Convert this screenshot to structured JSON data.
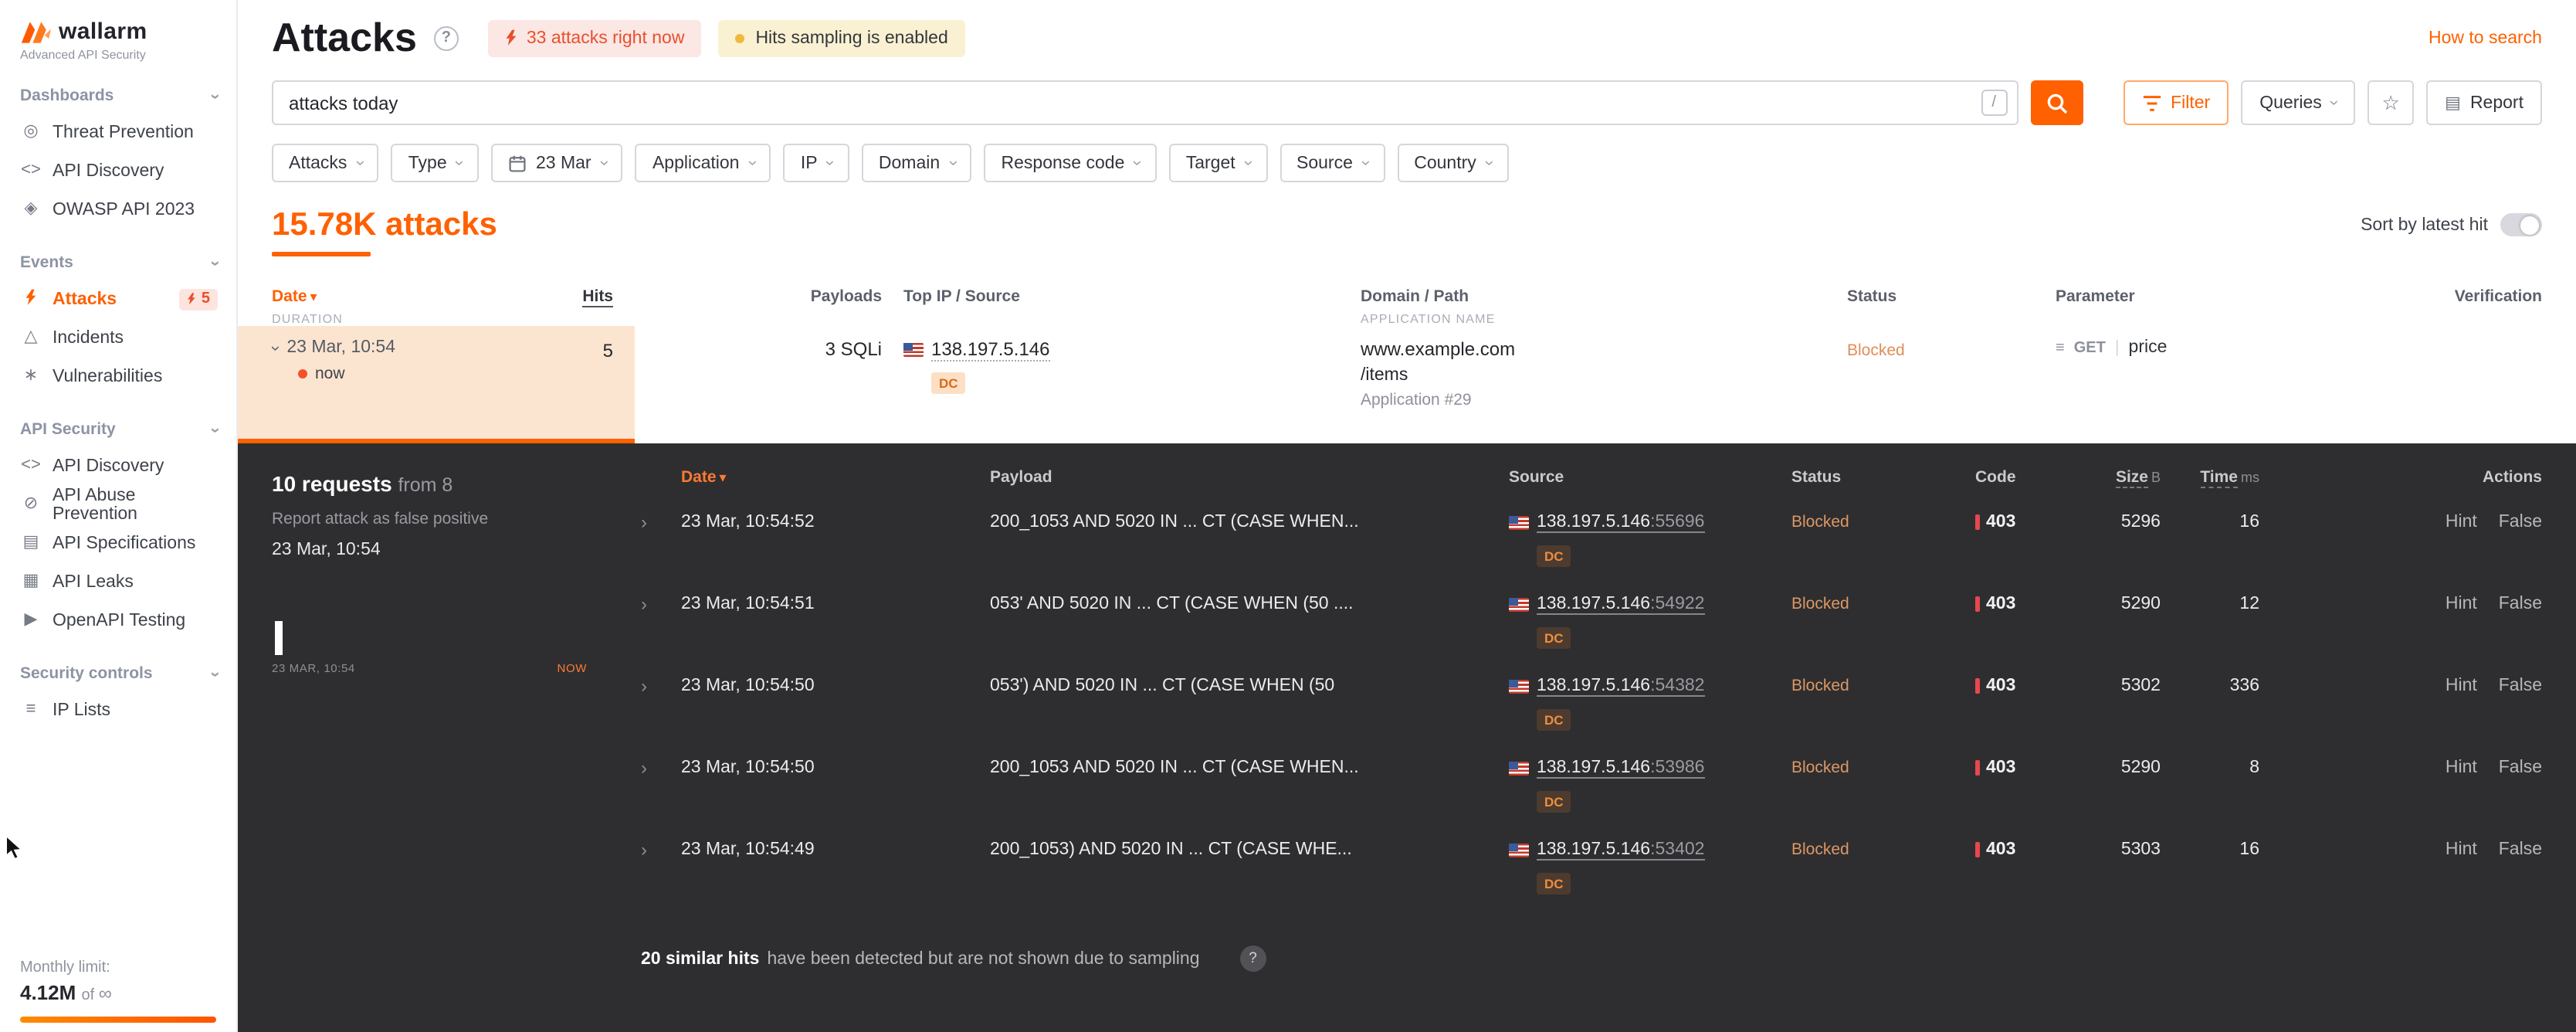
{
  "colors": {
    "accent": "#ff6000",
    "panel": "#2e2e30",
    "danger": "#e5484d",
    "blocked": "#dd9865"
  },
  "brand": {
    "name": "wallarm",
    "subtitle": "Advanced API Security"
  },
  "sidebar": {
    "sections": [
      {
        "title": "Dashboards",
        "items": [
          {
            "label": "Threat Prevention",
            "glyph": "◎"
          },
          {
            "label": "API Discovery",
            "glyph": "<>"
          },
          {
            "label": "OWASP API 2023",
            "glyph": "◈"
          }
        ]
      },
      {
        "title": "Events",
        "items": [
          {
            "label": "Attacks",
            "badge": "5"
          },
          {
            "label": "Incidents",
            "glyph": "△"
          },
          {
            "label": "Vulnerabilities",
            "glyph": "∗"
          }
        ]
      },
      {
        "title": "API Security",
        "items": [
          {
            "label": "API Discovery",
            "glyph": "<>"
          },
          {
            "label": "API Abuse Prevention",
            "glyph": "⊘"
          },
          {
            "label": "API Specifications",
            "glyph": "▤"
          },
          {
            "label": "API Leaks",
            "glyph": "▦"
          },
          {
            "label": "OpenAPI Testing",
            "glyph": "▶"
          }
        ]
      },
      {
        "title": "Security controls",
        "items": [
          {
            "label": "IP Lists",
            "glyph": "≡"
          }
        ]
      }
    ],
    "monthly_limit": {
      "label": "Monthly limit:",
      "value": "4.12M",
      "of": "of",
      "infinity": "∞"
    }
  },
  "header": {
    "title": "Attacks",
    "live_badge": "33 attacks right now",
    "sampling_badge": "Hits sampling is enabled",
    "help_link": "How to search"
  },
  "search": {
    "query": "attacks today",
    "shortcut": "/",
    "filter": "Filter",
    "queries": "Queries",
    "report": "Report"
  },
  "filters": [
    {
      "label": "Attacks"
    },
    {
      "label": "Type"
    },
    {
      "label": "23 Mar"
    },
    {
      "label": "Application"
    },
    {
      "label": "IP"
    },
    {
      "label": "Domain"
    },
    {
      "label": "Response code"
    },
    {
      "label": "Target"
    },
    {
      "label": "Source"
    },
    {
      "label": "Country"
    }
  ],
  "results": {
    "count": "15.78K attacks",
    "sort_label": "Sort by latest hit",
    "columns": {
      "date": "Date",
      "duration": "DURATION",
      "hits": "Hits",
      "payloads": "Payloads",
      "source": "Top IP / Source",
      "domain": "Domain / Path",
      "application": "APPLICATION NAME",
      "status": "Status",
      "parameter": "Parameter",
      "verification": "Verification"
    },
    "row": {
      "date": "23 Mar, 10:54",
      "live": "now",
      "hits": "5",
      "payloads": "3 SQLi",
      "country": "US",
      "ip": "138.197.5.146",
      "tag": "DC",
      "domain": "www.example.com",
      "path": "/items",
      "application": "Application #29",
      "status": "Blocked",
      "method": "GET",
      "parameter": "price"
    }
  },
  "detail": {
    "requests": "10 requests",
    "from": "from 8",
    "report_link": "Report attack as false positive",
    "date": "23 Mar, 10:54",
    "timeline": {
      "start": "23 MAR, 10:54",
      "end": "NOW"
    },
    "columns": {
      "date": "Date",
      "payload": "Payload",
      "source": "Source",
      "status": "Status",
      "code": "Code",
      "size": "Size",
      "size_unit": "B",
      "time": "Time",
      "time_unit": "ms",
      "actions": "Actions"
    },
    "hits": [
      {
        "date": "23 Mar, 10:54:52",
        "payload": "200_1053 AND 5020 IN ... CT (CASE WHEN...",
        "country": "US",
        "ip": "138.197.5.146",
        "port": ":55696",
        "tag": "DC",
        "status": "Blocked",
        "code": "403",
        "size": "5296",
        "time": "16",
        "hint": "Hint",
        "false_label": "False"
      },
      {
        "date": "23 Mar, 10:54:51",
        "payload": "053' AND 5020 IN ... CT (CASE WHEN (50 ....",
        "country": "US",
        "ip": "138.197.5.146",
        "port": ":54922",
        "tag": "DC",
        "status": "Blocked",
        "code": "403",
        "size": "5290",
        "time": "12",
        "hint": "Hint",
        "false_label": "False"
      },
      {
        "date": "23 Mar, 10:54:50",
        "payload": "053') AND 5020 IN ... CT (CASE WHEN (50",
        "country": "US",
        "ip": "138.197.5.146",
        "port": ":54382",
        "tag": "DC",
        "status": "Blocked",
        "code": "403",
        "size": "5302",
        "time": "336",
        "hint": "Hint",
        "false_label": "False"
      },
      {
        "date": "23 Mar, 10:54:50",
        "payload": "200_1053 AND 5020 IN ... CT (CASE WHEN...",
        "country": "US",
        "ip": "138.197.5.146",
        "port": ":53986",
        "tag": "DC",
        "status": "Blocked",
        "code": "403",
        "size": "5290",
        "time": "8",
        "hint": "Hint",
        "false_label": "False"
      },
      {
        "date": "23 Mar, 10:54:49",
        "payload": "200_1053) AND 5020 IN ... CT (CASE WHE...",
        "country": "US",
        "ip": "138.197.5.146",
        "port": ":53402",
        "tag": "DC",
        "status": "Blocked",
        "code": "403",
        "size": "5303",
        "time": "16",
        "hint": "Hint",
        "false_label": "False"
      }
    ],
    "sampling": {
      "bold": "20 similar hits",
      "rest": "have been detected but are not shown due to sampling",
      "help": "?"
    }
  }
}
